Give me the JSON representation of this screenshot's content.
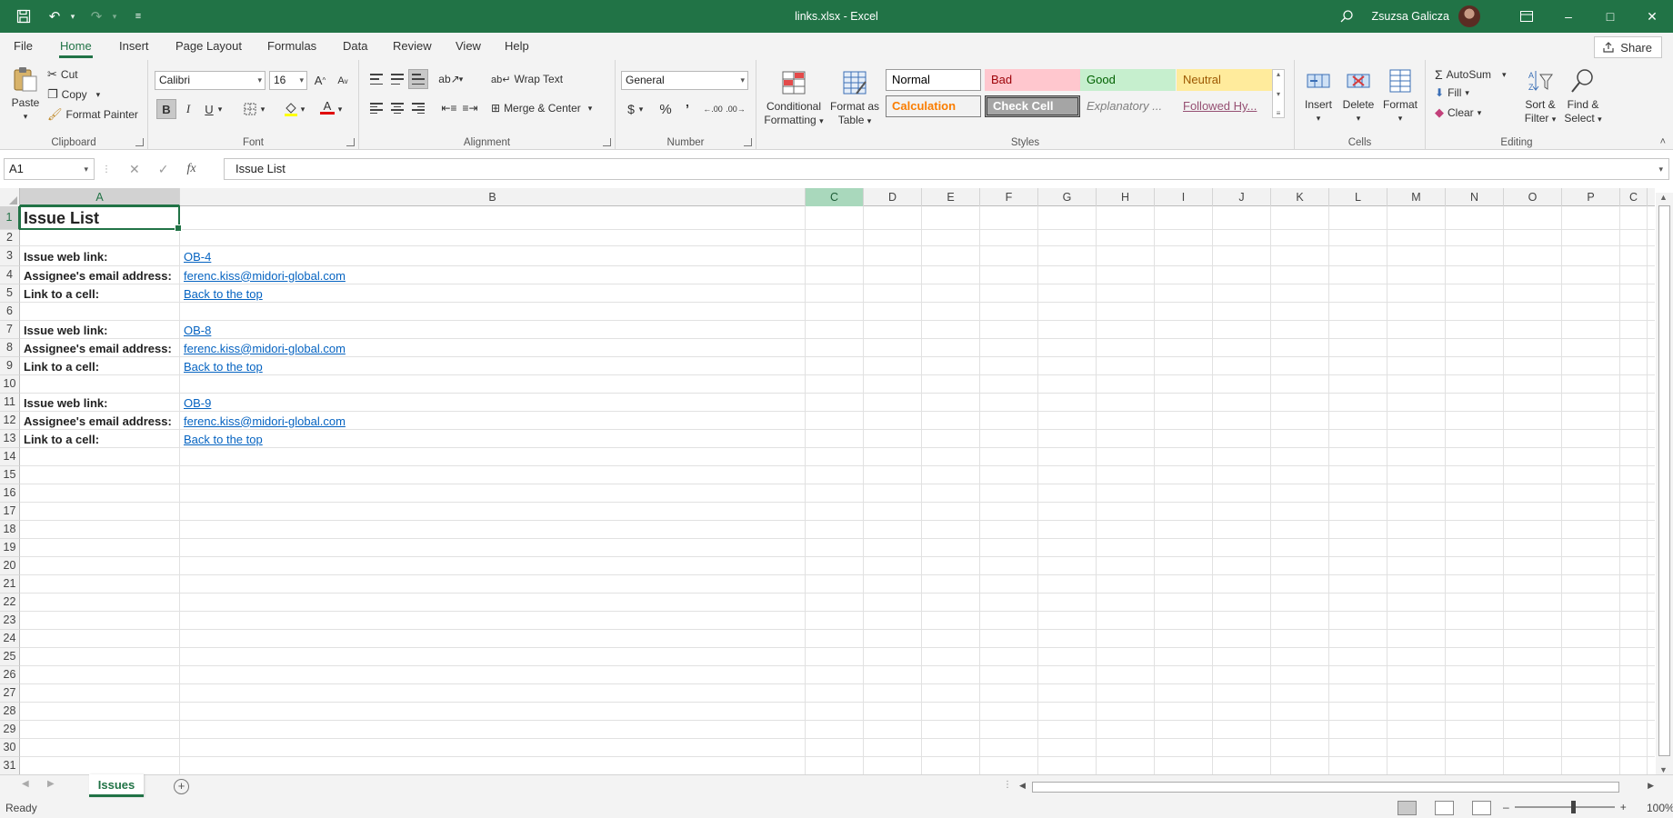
{
  "window": {
    "title": "links.xlsx - Excel",
    "user_name": "Zsuzsa Galicza"
  },
  "tabs": {
    "items": [
      "File",
      "Home",
      "Insert",
      "Page Layout",
      "Formulas",
      "Data",
      "Review",
      "View",
      "Help"
    ],
    "active": "Home",
    "share_label": "Share"
  },
  "ribbon": {
    "clipboard": {
      "paste": "Paste",
      "cut": "Cut",
      "copy": "Copy",
      "format_painter": "Format Painter",
      "label": "Clipboard"
    },
    "font": {
      "family": "Calibri",
      "size": "16",
      "label": "Font"
    },
    "alignment": {
      "wrap_text": "Wrap Text",
      "merge_center": "Merge & Center",
      "label": "Alignment"
    },
    "number": {
      "format": "General",
      "label": "Number"
    },
    "styles": {
      "conditional_formatting_1": "Conditional",
      "conditional_formatting_2": "Formatting",
      "format_as_table_1": "Format as",
      "format_as_table_2": "Table",
      "gallery": [
        "Normal",
        "Bad",
        "Good",
        "Neutral",
        "Calculation",
        "Check Cell",
        "Explanatory ...",
        "Followed Hy..."
      ],
      "label": "Styles"
    },
    "cells": {
      "insert": "Insert",
      "delete": "Delete",
      "format": "Format",
      "label": "Cells"
    },
    "editing": {
      "autosum": "AutoSum",
      "fill": "Fill",
      "clear": "Clear",
      "sort_filter_1": "Sort &",
      "sort_filter_2": "Filter",
      "find_select_1": "Find &",
      "find_select_2": "Select",
      "label": "Editing"
    }
  },
  "formula_bar": {
    "name_box": "A1",
    "content": "Issue List"
  },
  "sheet": {
    "columns": [
      "A",
      "B",
      "C",
      "D",
      "E",
      "F",
      "G",
      "H",
      "I",
      "J",
      "K",
      "L",
      "M",
      "N",
      "O",
      "P",
      "C"
    ],
    "rows": [
      "1",
      "2",
      "3",
      "4",
      "5",
      "6",
      "7",
      "8",
      "9",
      "10",
      "11",
      "12",
      "13",
      "14",
      "15",
      "16",
      "17",
      "18",
      "19",
      "20",
      "21",
      "22",
      "23",
      "24",
      "25",
      "26",
      "27",
      "28",
      "29",
      "30",
      "31"
    ],
    "cells": {
      "A1": "Issue List",
      "A3": "Issue web link:",
      "B3": "OB-4",
      "A4": "Assignee's email address:",
      "B4": "ferenc.kiss@midori-global.com",
      "A5": "Link to a cell:",
      "B5": "Back to the top",
      "A7": "Issue web link:",
      "B7": "OB-8",
      "A8": "Assignee's email address:",
      "B8": "ferenc.kiss@midori-global.com",
      "A9": "Link to a cell:",
      "B9": "Back to the top",
      "A11": "Issue web link:",
      "B11": "OB-9",
      "A12": "Assignee's email address:",
      "B12": "ferenc.kiss@midori-global.com",
      "A13": "Link to a cell:",
      "B13": "Back to the top"
    },
    "active_tab": "Issues"
  },
  "status": {
    "ready": "Ready",
    "zoom": "100%"
  }
}
